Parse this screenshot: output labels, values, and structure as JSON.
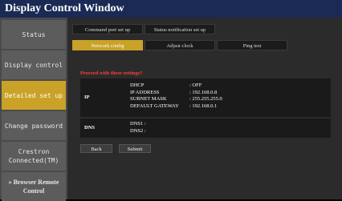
{
  "window": {
    "title": "Display Control Window"
  },
  "sidebar": {
    "items": [
      {
        "label": "Status"
      },
      {
        "label": "Display control"
      },
      {
        "label": "Detailed set up"
      },
      {
        "label": "Change password"
      },
      {
        "label": "Crestron Connected(TM)"
      },
      {
        "label": "» Browser Remote Control"
      }
    ]
  },
  "tabs": {
    "row1": [
      {
        "label": "Command port set up"
      },
      {
        "label": "Status notification set up"
      }
    ],
    "row2": [
      {
        "label": "Network config"
      },
      {
        "label": "Adjust clock"
      },
      {
        "label": "Ping test"
      }
    ]
  },
  "confirm": {
    "prompt": "Proceed with these settings?"
  },
  "ip": {
    "label": "IP",
    "rows": [
      {
        "key": "DHCP",
        "value": ": OFF"
      },
      {
        "key": "IP ADDRESS",
        "value": ": 192.168.0.8"
      },
      {
        "key": "SUBNET MASK",
        "value": ": 255.255.255.0"
      },
      {
        "key": "DEFAULT GATEWAY",
        "value": ": 192.168.0.1"
      }
    ]
  },
  "dns": {
    "label": "DNS",
    "rows": [
      {
        "key": "DNS1 :",
        "value": ""
      },
      {
        "key": "DNS2 :",
        "value": ""
      }
    ]
  },
  "actions": {
    "back": "Back",
    "submit": "Submit"
  }
}
